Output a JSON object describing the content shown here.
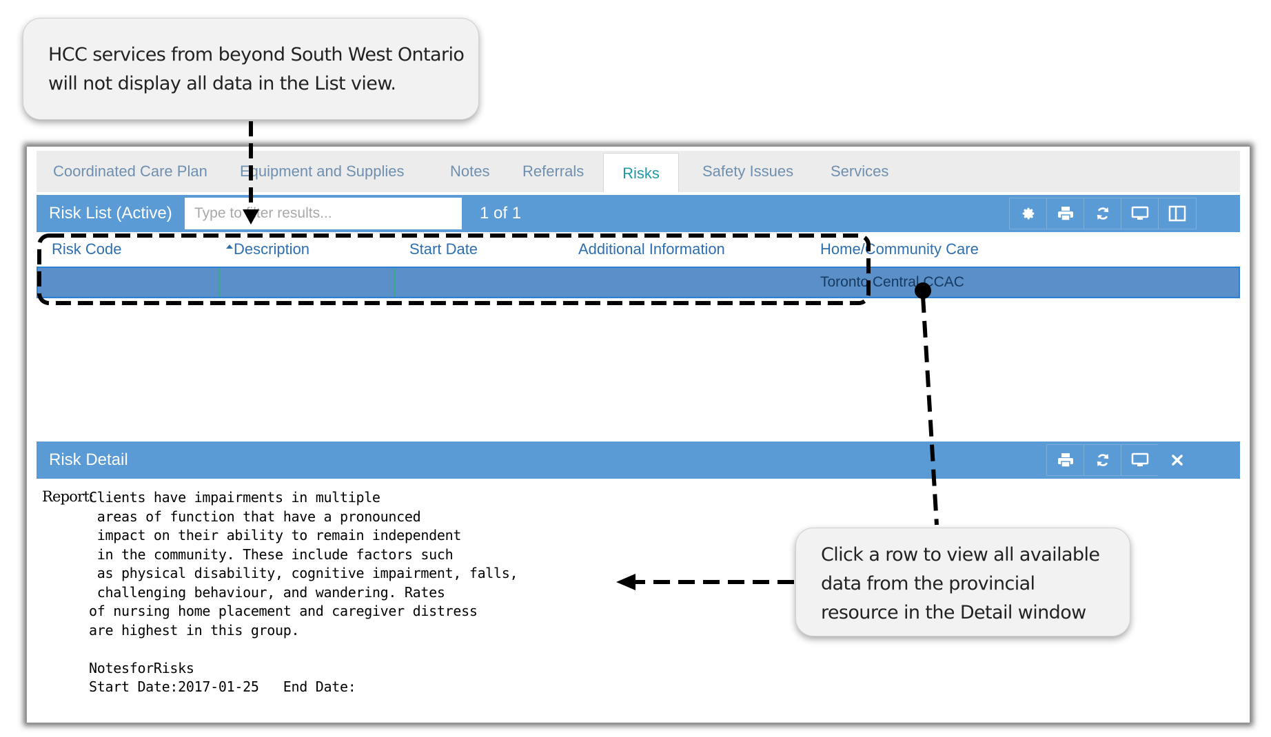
{
  "callouts": {
    "top_line1": "HCC services from beyond  South West Ontario",
    "top_line2": "will not display all data in the List view.",
    "bottom_line1": "Click a row to view all available",
    "bottom_line2": "data from the provincial",
    "bottom_line3": "resource in the Detail window"
  },
  "tabs": [
    {
      "label": "Coordinated Care Plan"
    },
    {
      "label": "Equipment and Supplies"
    },
    {
      "label": "Notes"
    },
    {
      "label": "Referrals"
    },
    {
      "label": "Risks",
      "active": true
    },
    {
      "label": "Safety Issues"
    },
    {
      "label": "Services"
    }
  ],
  "risk_list": {
    "title": "Risk List (Active)",
    "filter_placeholder": "Type to filter results...",
    "pager": "1 of 1",
    "toolbar_icons": [
      "gear-icon",
      "print-icon",
      "refresh-icon",
      "monitor-icon",
      "columns-icon"
    ],
    "columns": [
      "Risk Code",
      "Description",
      "Start Date",
      "Additional Information",
      "Home/Community Care"
    ],
    "rows": [
      {
        "risk_code": "",
        "description": "",
        "start_date": "",
        "additional_information": "",
        "home_community_care": "Toronto Central CCAC"
      }
    ]
  },
  "risk_detail": {
    "title": "Risk Detail",
    "toolbar_icons": [
      "print-icon",
      "refresh-icon",
      "monitor-icon",
      "close-icon"
    ],
    "report_label": "Report:",
    "report_text": "Clients have impairments in multiple\n areas of function that have a pronounced\n impact on their ability to remain independent\n in the community. These include factors such\n as physical disability, cognitive impairment, falls,\n challenging behaviour, and wandering. Rates\nof nursing home placement and caregiver distress\nare highest in this group.\n\nNotesforRisks\nStart Date:2017-01-25   End Date:"
  },
  "colors": {
    "header_blue": "#5b9bd5",
    "selected_row": "#5a8fc8",
    "link_blue": "#2e6fb2",
    "active_tab": "#1f9aa5"
  }
}
